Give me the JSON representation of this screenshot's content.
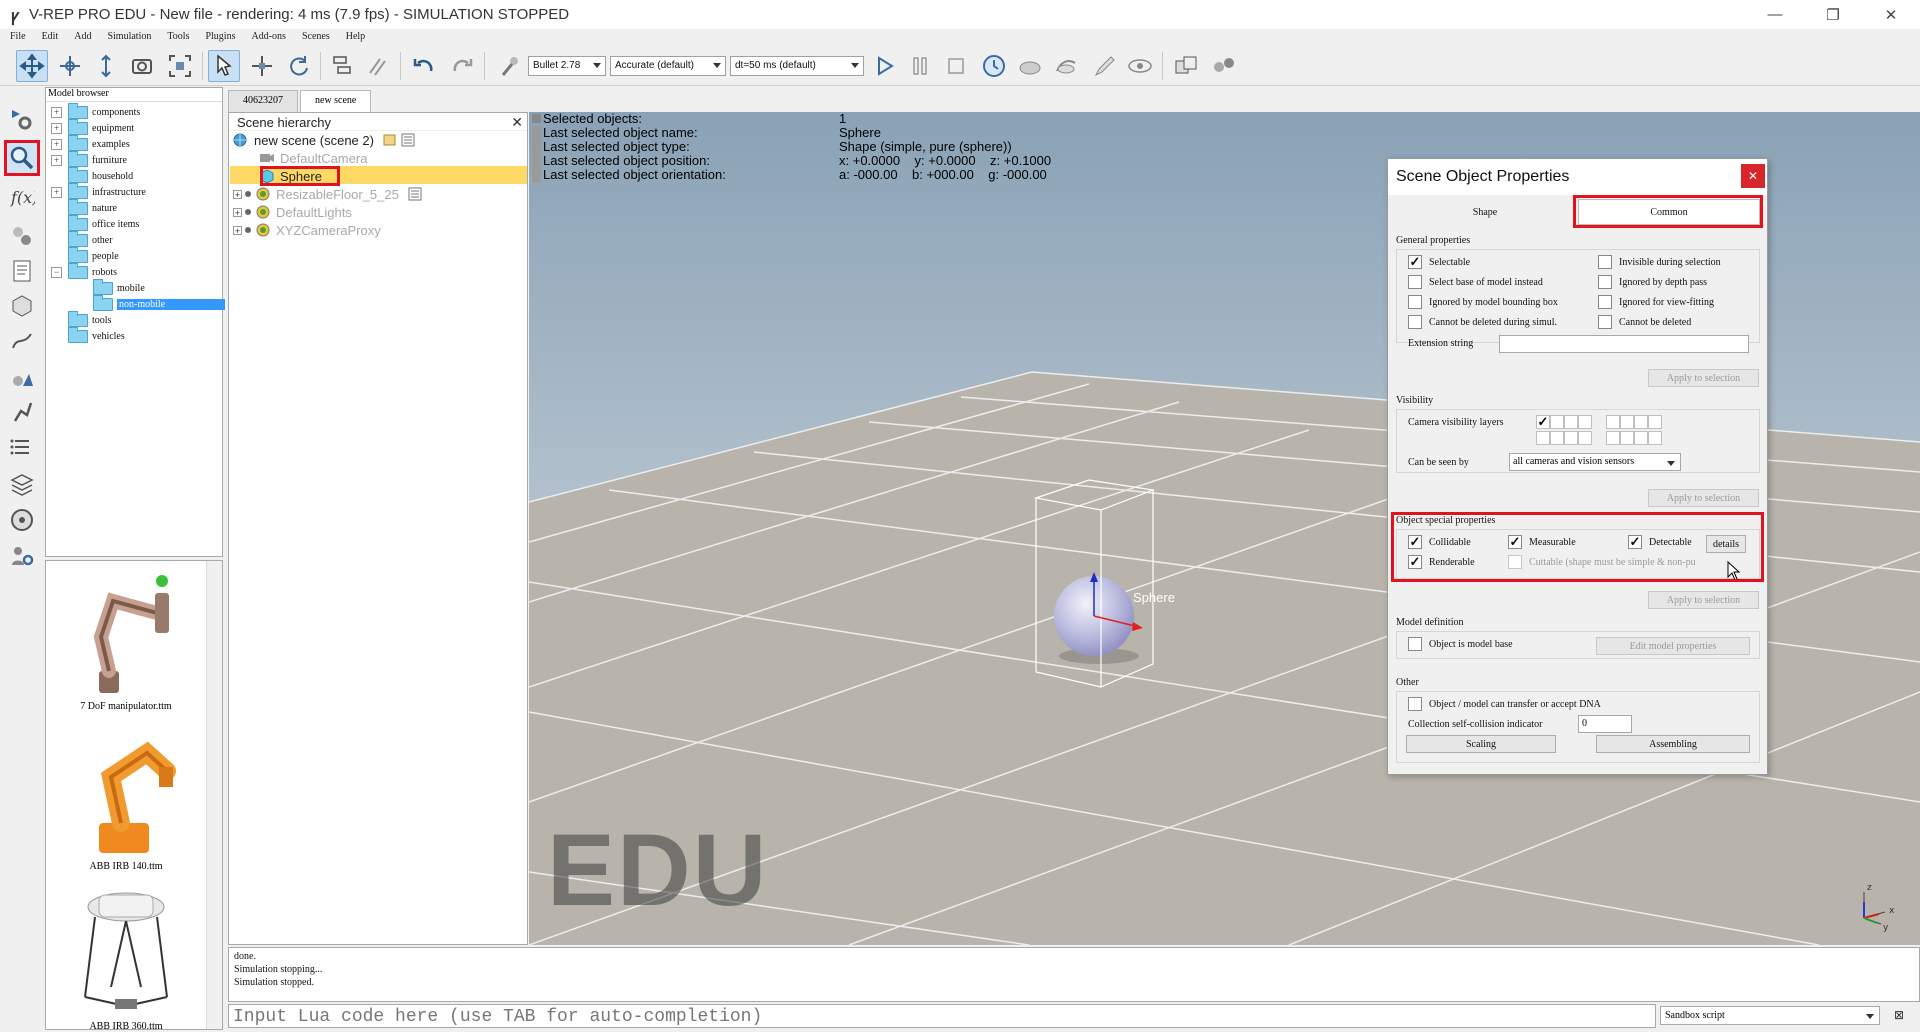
{
  "window": {
    "title": "V-REP PRO EDU - New file - rendering: 4 ms (7.9 fps) - SIMULATION STOPPED",
    "min": "—",
    "max": "❐",
    "close": "✕"
  },
  "menu": [
    "File",
    "Edit",
    "Add",
    "Simulation",
    "Tools",
    "Plugins",
    "Add-ons",
    "Scenes",
    "Help"
  ],
  "toolbar": {
    "engine": "Bullet 2.78",
    "accuracy": "Accurate (default)",
    "timestep": "dt=50 ms (default)"
  },
  "model_browser": {
    "title": "Model browser",
    "items": [
      {
        "label": "components",
        "pm": "+"
      },
      {
        "label": "equipment",
        "pm": "+"
      },
      {
        "label": "examples",
        "pm": "+"
      },
      {
        "label": "furniture",
        "pm": "+"
      },
      {
        "label": "household",
        "pm": ""
      },
      {
        "label": "infrastructure",
        "pm": "+"
      },
      {
        "label": "nature",
        "pm": ""
      },
      {
        "label": "office items",
        "pm": ""
      },
      {
        "label": "other",
        "pm": ""
      },
      {
        "label": "people",
        "pm": ""
      },
      {
        "label": "robots",
        "pm": "−"
      },
      {
        "label": "mobile",
        "pm": ""
      },
      {
        "label": "non-mobile",
        "pm": ""
      },
      {
        "label": "tools",
        "pm": ""
      },
      {
        "label": "vehicles",
        "pm": ""
      }
    ],
    "thumbnails": [
      "7 DoF manipulator.ttm",
      "ABB IRB 140.ttm",
      "ABB IRB 360.ttm"
    ]
  },
  "scene_tabs": [
    "40623207",
    "new scene"
  ],
  "hierarchy": {
    "title": "Scene hierarchy",
    "close": "✕",
    "root": "new scene (scene 2)",
    "items": [
      "DefaultCamera",
      "Sphere",
      "ResizableFloor_5_25",
      "DefaultLights",
      "XYZCameraProxy"
    ]
  },
  "selection_info": {
    "labels": [
      "Selected objects:",
      "Last selected object name:",
      "Last selected object type:",
      "Last selected object position:",
      "Last selected object orientation:"
    ],
    "count": "1",
    "name": "Sphere",
    "type": "Shape (simple, pure (sphere))",
    "position": "x: +0.0000    y: +0.0000    z: +0.1000",
    "orientation": "a: -000.00    b: +000.00    g: -000.00"
  },
  "viewport": {
    "object_label": "Sphere",
    "watermark": "EDU",
    "axis_z": "z",
    "axis_x": "x",
    "axis_y": "y"
  },
  "dialog": {
    "title": "Scene Object Properties",
    "close": "✕",
    "tab_shape": "Shape",
    "tab_common": "Common",
    "general": {
      "label": "General properties",
      "selectable": "Selectable",
      "invisible_selection": "Invisible during selection",
      "select_base": "Select base of model instead",
      "ignored_depth": "Ignored by depth pass",
      "ignored_bbox": "Ignored by model bounding  box",
      "ignored_view": "Ignored for view-fitting",
      "cannot_delete_sim": "Cannot be deleted during simul.",
      "cannot_delete": "Cannot be deleted",
      "extension": "Extension string",
      "apply": "Apply to selection"
    },
    "visibility": {
      "label": "Visibility",
      "layers": "Camera visibility layers",
      "seen_by": "Can be seen by",
      "seen_by_value": "all cameras and vision sensors",
      "apply": "Apply to selection"
    },
    "special": {
      "label": "Object special properties",
      "collidable": "Collidable",
      "measurable": "Measurable",
      "detectable": "Detectable",
      "details": "details",
      "renderable": "Renderable",
      "cuttable": "Cuttable (shape must be simple & non-pu",
      "apply": "Apply to selection"
    },
    "model": {
      "label": "Model definition",
      "is_base": "Object is model base",
      "edit": "Edit model properties"
    },
    "other": {
      "label": "Other",
      "dna": "Object / model can transfer or accept DNA",
      "collision_indicator": "Collection self-collision indicator",
      "collision_value": "0",
      "scaling": "Scaling",
      "assembling": "Assembling"
    }
  },
  "console": {
    "lines": [
      "done.",
      "Simulation stopping...",
      "Simulation stopped."
    ]
  },
  "lua": {
    "placeholder": "Input Lua code here (use TAB for auto-completion)",
    "script": "Sandbox script"
  },
  "colors": {
    "highlight_red": "#e0141e",
    "selection_yellow": "#ffd966",
    "browser_selection": "#3399ff"
  }
}
